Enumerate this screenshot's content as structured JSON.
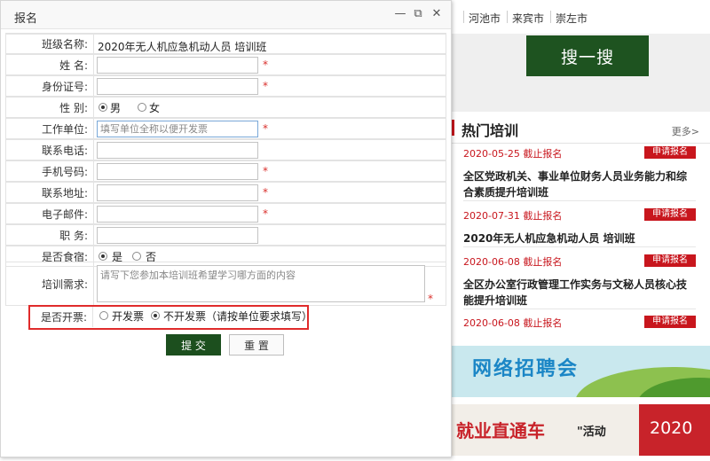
{
  "background": {
    "cities": [
      "河池市",
      "来宾市",
      "崇左市"
    ],
    "search_button": "搜一搜",
    "hot": {
      "title": "热门培训",
      "more": "更多>",
      "items": [
        {
          "date": "2020-05-25 截止报名",
          "apply": "申请报名",
          "desc": "全区党政机关、事业单位财务人员业务能力和综合素质提升培训班"
        },
        {
          "date": "2020-07-31 截止报名",
          "apply": "申请报名",
          "desc": "2020年无人机应急机动人员 培训班"
        },
        {
          "date": "2020-06-08 截止报名",
          "apply": "申请报名",
          "desc": "全区办公室行政管理工作实务与文秘人员核心技能提升培训班"
        },
        {
          "date": "2020-06-08 截止报名",
          "apply": "申请报名",
          "desc": ""
        }
      ]
    },
    "banner1_text": "网络招聘会",
    "banner2_text": "就业直通车",
    "banner2_text2": "\"活动",
    "banner2_year": "2020"
  },
  "dialog": {
    "title": "报名",
    "controls": {
      "minimize": "—",
      "maximize": "⧉",
      "close": "✕"
    },
    "form": {
      "class_name_label": "班级名称:",
      "class_name_value": "2020年无人机应急机动人员 培训班",
      "name_label": "姓      名:",
      "id_label": "身份证号:",
      "gender_label": "性      别:",
      "gender_options": [
        "男",
        "女"
      ],
      "work_label": "工作单位:",
      "work_placeholder": "填写单位全称以便开发票",
      "phone_label": "联系电话:",
      "mobile_label": "手机号码:",
      "address_label": "联系地址:",
      "email_label": "电子邮件:",
      "position_label": "职      务:",
      "lodging_label": "是否食宿:",
      "lodging_options": [
        "是",
        "否"
      ],
      "needs_label": "培训需求:",
      "needs_placeholder": "请写下您参加本培训班希望学习哪方面的内容",
      "invoice_label": "是否开票:",
      "invoice_options": [
        "开发票",
        "不开发票（请按单位要求填写）"
      ],
      "required_mark": "*"
    },
    "buttons": {
      "submit": "提 交",
      "reset": "重 置"
    }
  }
}
